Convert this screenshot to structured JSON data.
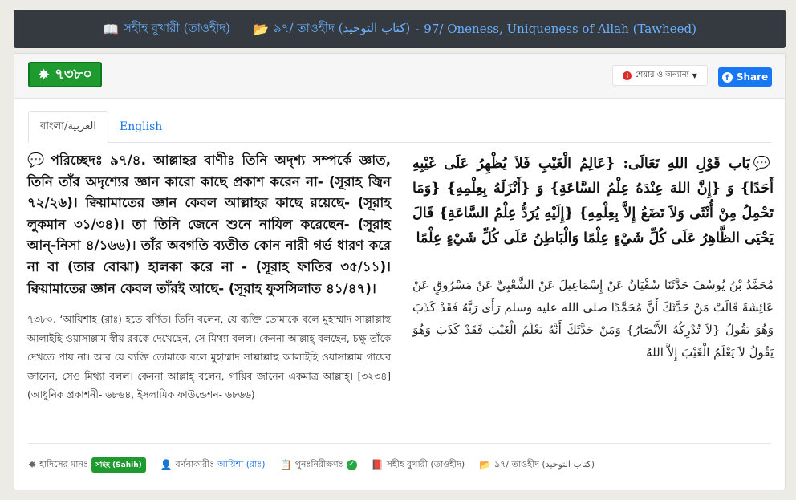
{
  "breadcrumb": {
    "book": "সহীহ বুখারী (তাওহীদ)",
    "chapter_bn": "৯৭/ তাওহীদ (كتاب التوحيد)",
    "dash": "-",
    "chapter_en": "97/ Oneness, Uniqueness of Allah (Tawheed)",
    "book_icon": "book-reader-icon",
    "folder_icon": "folder-open-icon"
  },
  "header": {
    "hadith_number": "৭৩৮০",
    "share_menu_label": "শেয়ার ও অন্যান্য",
    "fb_share_label": "Share",
    "accent_color": "#1e9a2f",
    "fb_color": "#1877f2"
  },
  "tabs": [
    {
      "label": "বাংলা/العربية",
      "active": true
    },
    {
      "label": "English",
      "active": false
    }
  ],
  "bangla": {
    "chapter": "পরিচ্ছেদঃ ৯৭/৪. আল্লাহর বাণীঃ তিনি অদৃশ্য সম্পর্কে জ্ঞাত, তিনি তাঁর অদৃশ্যের জ্ঞান কারো কাছে প্রকাশ করেন না- (সূরাহ জ্বিন ৭২/২৬)। ক্বিয়ামাতের জ্ঞান কেবল আল্লাহর কাছে রয়েছে- (সূরাহ লুকমান ৩১/৩৪)। তা তিনি জেনে শুনে নাযিল করেছেন- (সূরাহ আন্-নিসা ৪/১৬৬)। তাঁর অবগতি ব্যতীত কোন নারী গর্ভ ধারণ করে না বা (তার বোঝা) হালকা করে না - (সূরাহ ফাতির ৩৫/১১)। ক্বিয়ামাতের জ্ঞান কেবল তাঁরই আছে- (সূরাহ ফুসসিলাত ৪১/৪৭)।",
    "body": "৭৩৮০. ‘আয়িশাহ (রাঃ) হতে বর্ণিত। তিনি বলেন, যে ব্যক্তি তোমাকে বলে মুহাম্মাদ সাল্লাল্লাহু আলাইহি ওয়াসাল্লাম স্বীয় রবকে দেখেছেন, সে মিথ্যা বলল। কেননা আল্লাহ্ বলছেন, চক্ষু তাঁকে দেখতে পায় না। আর যে ব্যক্তি তোমাকে বলে মুহাম্মাদ সাল্লাল্লাহু আলাইহি ওয়াসাল্লাম গায়েব জানেন, সেও মিথ্যা বলল। কেননা আল্লাহ্ বলেন, গায়িব জানেন একমাত্র আল্লাহ্। [৩২৩৪] (আধুনিক প্রকাশনী- ৬৮৬৪, ইসলামিক ফাউন্ডেশন- ৬৮৬৬)"
  },
  "arabic": {
    "chapter": "بَاب قَوْلِ اللهِ تَعَالَى: {عَالِمُ الْغَيْبِ فَلاَ يُظْهِرُ عَلَى غَيْبِهِ أَحَدًا} وَ {إِنَّ اللهَ عِنْدَهُ عِلْمُ السَّاعَةِ} وَ {أَنْزَلَهُ بِعِلْمِهِ} {وَمَا تَحْمِلُ مِنْ أُنْثَى وَلاَ تَضَعُ إِلاَّ بِعِلْمِهِ} {إِلَيْهِ يُرَدُّ عِلْمُ السَّاعَةِ} قَالَ يَحْيَى الظَّاهِرُ عَلَى كُلِّ شَيْءٍ عِلْمًا وَالْبَاطِنُ عَلَى كُلِّ شَيْءٍ عِلْمًا",
    "body": "مُحَمَّدُ بْنُ يُوسُفَ حَدَّثَنَا سُفْيَانُ عَنْ إِسْمَاعِيلَ عَنْ الشَّعْبِيِّ عَنْ مَسْرُوقٍ عَنْ عَائِشَةَ قَالَتْ مَنْ حَدَّثَكَ أَنَّ مُحَمَّدًا صلى الله عليه وسلم رَأَى رَبَّهُ فَقَدْ كَذَبَ وَهُوَ يَقُولُ {لاَ تُدْرِكُهُ الأَبْصَارُ} وَمَنْ حَدَّثَكَ أَنَّهُ يَعْلَمُ الْغَيْبَ فَقَدْ كَذَبَ وَهُوَ يَقُولُ لاَ يَعْلَمُ الْغَيْبَ إِلاَّ اللهُ"
  },
  "footer": {
    "grade_label": "হাদিসের মানঃ",
    "grade_value": "সহিহ (Sahih)",
    "narrator_label": "বর্ণনাকারীঃ",
    "narrator_value": "আয়িশা (রাঃ)",
    "review_label": "পুনঃনিরীক্ষণঃ",
    "book": "সহীহ বুখারী (তাওহীদ)",
    "chapter": "৯৭/ তাওহীদ (كتاب التوحيد)"
  }
}
